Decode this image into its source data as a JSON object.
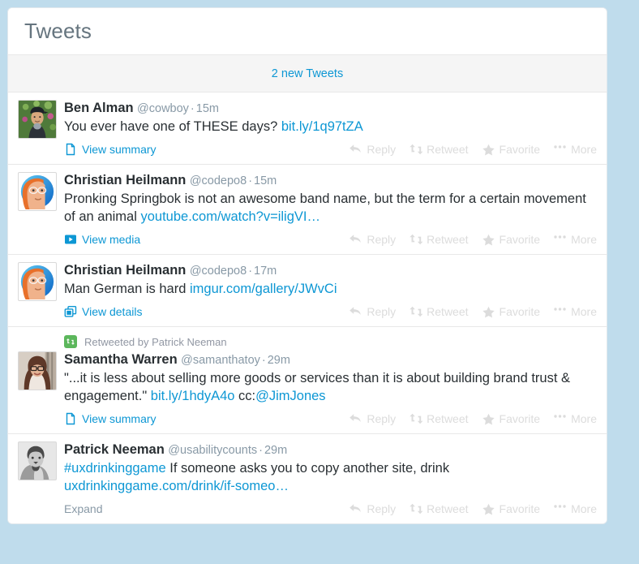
{
  "page": {
    "background_color": "#bfdcec",
    "card_background": "#ffffff",
    "link_color": "#0d97d4",
    "action_color": "#dcdcdc",
    "retweet_badge_color": "#5cb75c"
  },
  "header": {
    "title": "Tweets"
  },
  "new_tweets_bar": {
    "label": "2 new Tweets"
  },
  "actions": {
    "reply": "Reply",
    "retweet": "Retweet",
    "favorite": "Favorite",
    "more": "More"
  },
  "tweets": [
    {
      "fullname": "Ben Alman",
      "username": "@cowboy",
      "separator": "·",
      "timestamp": "15m",
      "text_before": "You ever have one of THESE days? ",
      "link": "bit.ly/1q97tZA",
      "text_after": "",
      "expand_label": "View summary",
      "expand_icon": "page-icon",
      "avatar": "ben-alman-avatar",
      "retweeted_by": null
    },
    {
      "fullname": "Christian Heilmann",
      "username": "@codepo8",
      "separator": "·",
      "timestamp": "15m",
      "text_before": "Pronking Springbok is not an awesome band name, but the term for a certain movement of an animal ",
      "link": "youtube.com/watch?v=iligVI…",
      "text_after": "",
      "expand_label": "View media",
      "expand_icon": "play-icon",
      "avatar": "christian-heilmann-avatar",
      "retweeted_by": null
    },
    {
      "fullname": "Christian Heilmann",
      "username": "@codepo8",
      "separator": "·",
      "timestamp": "17m",
      "text_before": "Man German is hard ",
      "link": "imgur.com/gallery/JWvCi",
      "text_after": "",
      "expand_label": "View details",
      "expand_icon": "windows-icon",
      "avatar": "christian-heilmann-avatar",
      "retweeted_by": null
    },
    {
      "fullname": "Samantha Warren",
      "username": "@samanthatoy",
      "separator": "·",
      "timestamp": "29m",
      "text_before": "\"...it is less about selling more goods or services than it is about building brand trust & engagement.\" ",
      "link": "bit.ly/1hdyA4o",
      "text_after": " cc:",
      "mention": "@JimJones",
      "expand_label": "View summary",
      "expand_icon": "page-icon",
      "avatar": "samantha-warren-avatar",
      "retweeted_by": "Retweeted by Patrick Neeman"
    },
    {
      "fullname": "Patrick Neeman",
      "username": "@usabilitycounts",
      "separator": "·",
      "timestamp": "29m",
      "hashtag": "#uxdrinkinggame",
      "text_before": " If someone asks you to copy another site, drink ",
      "link": "uxdrinkinggame.com/drink/if-someo…",
      "text_after": "",
      "expand_label": "Expand",
      "expand_icon": "none",
      "avatar": "patrick-neeman-avatar",
      "retweeted_by": null
    }
  ]
}
